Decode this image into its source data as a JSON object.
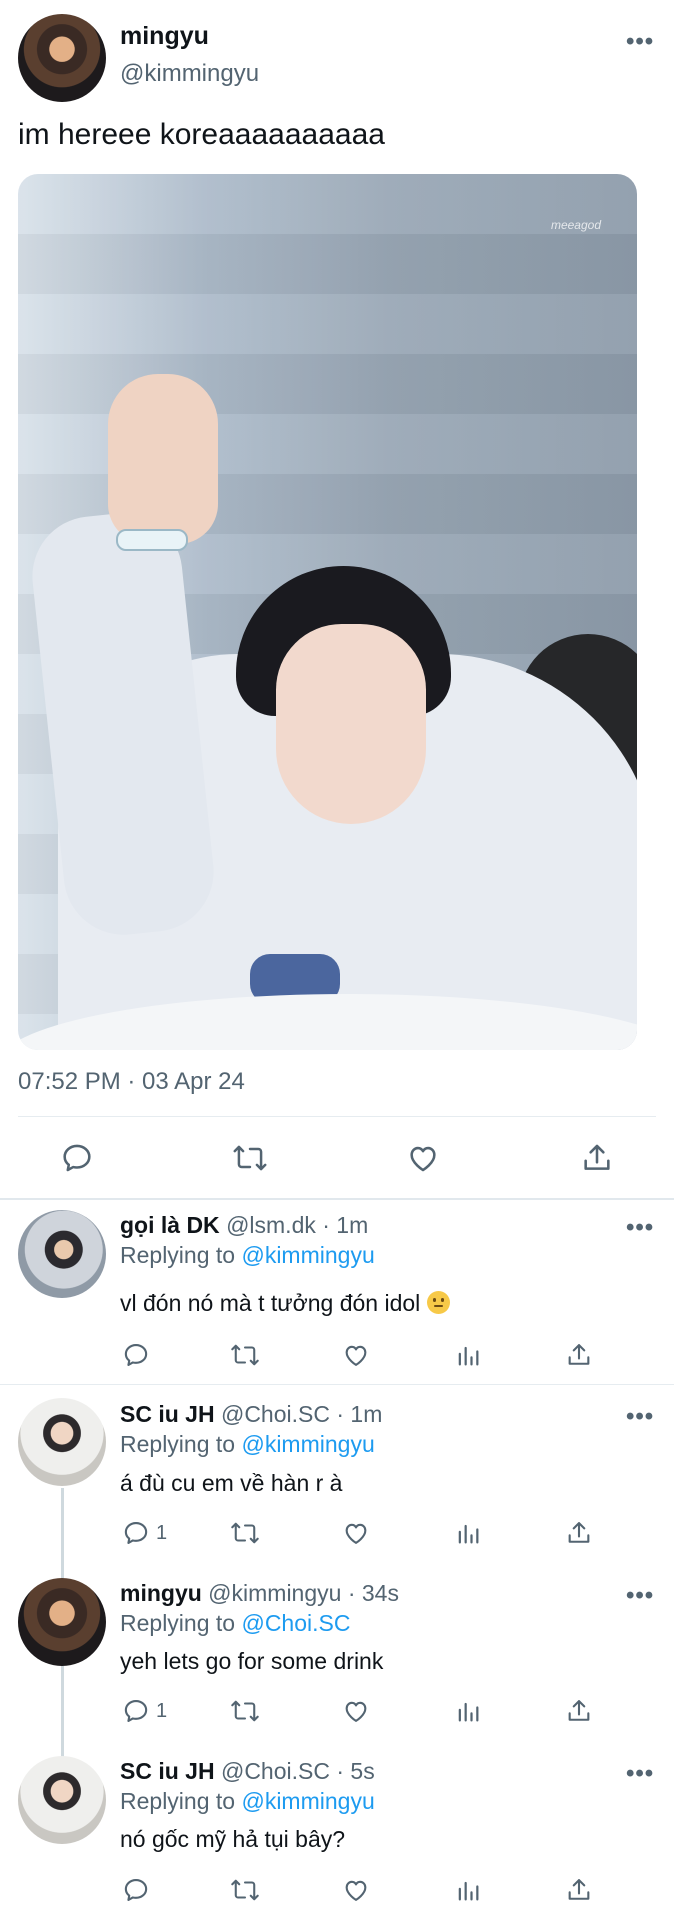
{
  "main_tweet": {
    "name": "mingyu",
    "handle": "@kimmingyu",
    "text": "im hereee koreaaaaaaaaaa",
    "photo_watermark": "meeagod",
    "timestamp": "07:52 PM · 03 Apr 24",
    "more_label": "•••",
    "actions": [
      "reply-icon",
      "retweet-icon",
      "like-icon",
      "share-icon"
    ]
  },
  "replies": [
    {
      "name": "gọi là DK",
      "meta": "@lsm.dk · 1m",
      "replying_prefix": "Replying to",
      "replying_to": "@kimmingyu",
      "text": "vl đón nó mà t tưởng đón idol",
      "emoji": "slightly-smiling-face",
      "reply_count": "",
      "more_label": "•••"
    },
    {
      "name": "SC iu JH",
      "meta": "@Choi.SC · 1m",
      "replying_prefix": "Replying to",
      "replying_to": "@kimmingyu",
      "text": "á đù cu em về hàn r à",
      "reply_count": "1",
      "more_label": "•••"
    },
    {
      "name": "mingyu",
      "meta": "@kimmingyu · 34s",
      "replying_prefix": "Replying to",
      "replying_to": "@Choi.SC",
      "text": "yeh lets go for some drink",
      "reply_count": "1",
      "more_label": "•••"
    },
    {
      "name": "SC iu JH",
      "meta": "@Choi.SC · 5s",
      "replying_prefix": "Replying to",
      "replying_to": "@kimmingyu",
      "text": "nó gốc mỹ hả tụi bây?",
      "reply_count": "",
      "more_label": "•••"
    }
  ],
  "reply_actions": [
    "reply-icon",
    "retweet-icon",
    "like-icon",
    "views-icon",
    "share-icon"
  ],
  "colors": {
    "text": "#0f1419",
    "secondary": "#536471",
    "link": "#1d9bf0",
    "divider": "#e6ecf0"
  }
}
